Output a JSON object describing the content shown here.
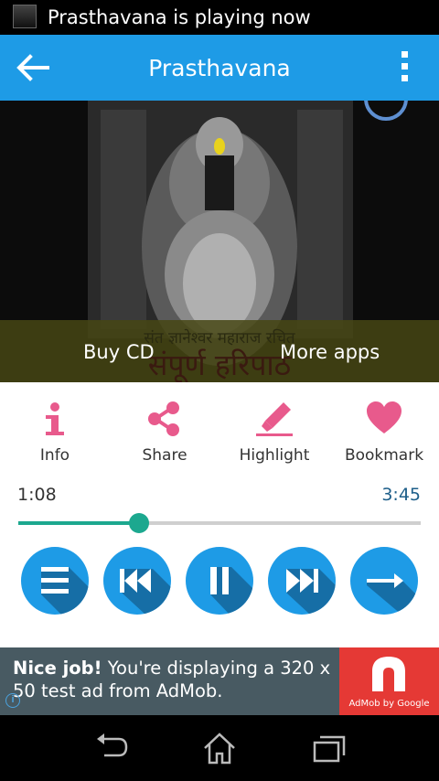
{
  "status_bar": {
    "notification_text": "Prasthavana is playing now",
    "thumbnail_icon": "album-art-thumbnail"
  },
  "app_bar": {
    "title": "Prasthavana",
    "back_icon": "arrow-left-icon",
    "menu_icon": "more-vert-icon",
    "color": "#1e9be6"
  },
  "hero": {
    "banner_text_line1": "संत ज्ञानेश्वर महाराज रचित",
    "banner_text_line2": "संपूर्ण हरिपाठ",
    "buy_cd_label": "Buy CD",
    "more_apps_label": "More apps"
  },
  "actions": [
    {
      "label": "Info",
      "icon": "info-icon"
    },
    {
      "label": "Share",
      "icon": "share-icon"
    },
    {
      "label": "Highlight",
      "icon": "highlighter-pen-icon"
    },
    {
      "label": "Bookmark",
      "icon": "heart-icon"
    }
  ],
  "action_icon_color": "#e85a8c",
  "player": {
    "current_time": "1:08",
    "total_time": "3:45",
    "progress": 0.3,
    "seek_color": "#1ca88f",
    "controls": [
      {
        "name": "playlist",
        "icon": "playlist-icon"
      },
      {
        "name": "previous",
        "icon": "skip-previous-icon"
      },
      {
        "name": "pause",
        "icon": "pause-icon"
      },
      {
        "name": "next",
        "icon": "skip-next-icon"
      },
      {
        "name": "forward",
        "icon": "arrow-right-icon"
      }
    ]
  },
  "ad": {
    "headline": "Nice job!",
    "body": " You're displaying a 320 x 50 test ad from AdMob.",
    "logo_caption": "AdMob by Google",
    "info_icon": "info-circle-icon"
  },
  "nav_bar": {
    "back_icon": "nav-back-icon",
    "home_icon": "nav-home-icon",
    "recents_icon": "nav-recents-icon"
  }
}
